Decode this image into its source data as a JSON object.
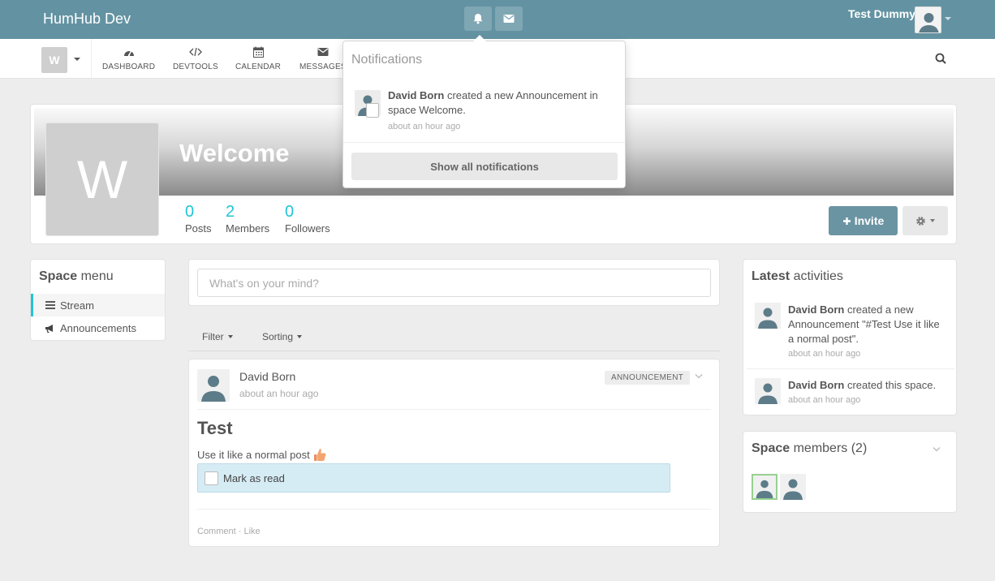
{
  "topbar": {
    "brand": "HumHub Dev",
    "user_name": "Test Dummy",
    "bar_color": "#6393a2"
  },
  "subnav": {
    "space_initial": "W",
    "items": [
      {
        "label": "DASHBOARD",
        "icon": "dashboard-icon"
      },
      {
        "label": "DEVTOOLS",
        "icon": "code-icon"
      },
      {
        "label": "CALENDAR",
        "icon": "calendar-icon"
      },
      {
        "label": "MESSAGES",
        "icon": "envelope-icon"
      }
    ]
  },
  "space": {
    "initial": "W",
    "title": "Welcome",
    "stats": [
      {
        "value": "0",
        "label": "Posts"
      },
      {
        "value": "2",
        "label": "Members"
      },
      {
        "value": "0",
        "label": "Followers"
      }
    ],
    "invite_label": "Invite"
  },
  "space_menu": {
    "heading_bold": "Space",
    "heading_rest": " menu",
    "items": [
      {
        "label": "Stream",
        "icon": "bars-icon",
        "active": true
      },
      {
        "label": "Announcements",
        "icon": "bullhorn-icon",
        "active": false
      }
    ]
  },
  "composer": {
    "placeholder": "What's on your mind?"
  },
  "filters": {
    "filter_label": "Filter",
    "sorting_label": "Sorting"
  },
  "post": {
    "author": "David Born",
    "time": "about an hour ago",
    "badge": "ANNOUNCEMENT",
    "title": "Test",
    "body": "Use it like a normal post",
    "mark_read": "Mark as read",
    "comment": "Comment",
    "separator": "·",
    "like": "Like"
  },
  "activities": {
    "heading_bold": "Latest",
    "heading_rest": " activities",
    "items": [
      {
        "author": "David Born",
        "text": " created a new Announcement \"#Test Use it like a normal post\".",
        "time": "about an hour ago"
      },
      {
        "author": "David Born",
        "text": " created this space.",
        "time": "about an hour ago"
      }
    ]
  },
  "members": {
    "heading_bold": "Space",
    "heading_rest": " members (2)"
  },
  "notifications": {
    "title": "Notifications",
    "item_author": "David Born",
    "item_text": " created a new Announcement in space Welcome.",
    "item_time": "about an hour ago",
    "show_all": "Show all notifications"
  },
  "colors": {
    "accent": "#21c4d6",
    "invite_button": "#6b94a3"
  }
}
